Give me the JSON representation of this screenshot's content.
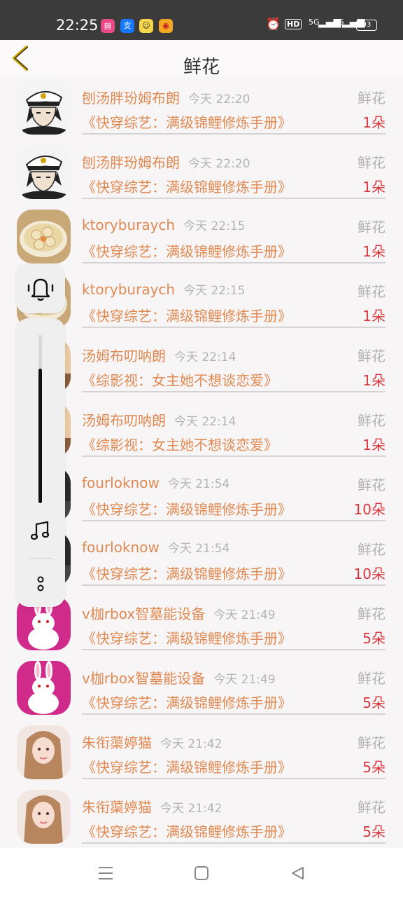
{
  "status_bar": {
    "time": "22:25",
    "hd_label": "HD",
    "signal_1": "5G",
    "signal_2": "4G",
    "battery": "93",
    "app_icons": [
      "pink-app-icon",
      "alipay-icon",
      "yellow-app-icon",
      "weibo-icon"
    ]
  },
  "header": {
    "title": "鲜花",
    "back_icon": "chevron-left-icon"
  },
  "rows": [
    {
      "name": "刨汤胖玢姆布朗",
      "time": "今天 22:20",
      "type": "鲜花",
      "book": "《快穿综艺：满级锦鲤修炼手册》",
      "count": "1朵",
      "avatar": "anime-captain"
    },
    {
      "name": "刨汤胖玢姆布朗",
      "time": "今天 22:20",
      "type": "鲜花",
      "book": "《快穿综艺：满级锦鲤修炼手册》",
      "count": "1朵",
      "avatar": "anime-captain"
    },
    {
      "name": "ktoryburaych",
      "time": "今天 22:15",
      "type": "鲜花",
      "book": "《快穿综艺：满级锦鲤修炼手册》",
      "count": "1朵",
      "avatar": "food-bowl"
    },
    {
      "name": "ktoryburaych",
      "time": "今天 22:15",
      "type": "鲜花",
      "book": "《快穿综艺：满级锦鲤修炼手册》",
      "count": "1朵",
      "avatar": "food-bowl"
    },
    {
      "name": "汤姆布叨呐朗",
      "time": "今天 22:14",
      "type": "鲜花",
      "book": "《综影视：女主她不想谈恋爱》",
      "count": "1朵",
      "avatar": "warm-photo"
    },
    {
      "name": "汤姆布叨呐朗",
      "time": "今天 22:14",
      "type": "鲜花",
      "book": "《综影视：女主她不想谈恋爱》",
      "count": "1朵",
      "avatar": "warm-photo"
    },
    {
      "name": "fourloknow",
      "time": "今天 21:54",
      "type": "鲜花",
      "book": "《快穿综艺：满级锦鲤修炼手册》",
      "count": "10朵",
      "avatar": "dark-photo"
    },
    {
      "name": "fourloknow",
      "time": "今天 21:54",
      "type": "鲜花",
      "book": "《快穿综艺：满级锦鲤修炼手册》",
      "count": "10朵",
      "avatar": "dark-photo"
    },
    {
      "name": "v枷rbox智墓能设备",
      "time": "今天 21:49",
      "type": "鲜花",
      "book": "《快穿综艺：满级锦鲤修炼手册》",
      "count": "5朵",
      "avatar": "white-rabbit"
    },
    {
      "name": "v枷rbox智墓能设备",
      "time": "今天 21:49",
      "type": "鲜花",
      "book": "《快穿综艺：满级锦鲤修炼手册》",
      "count": "5朵",
      "avatar": "white-rabbit"
    },
    {
      "name": "朱衔蕖婷猫",
      "time": "今天 21:42",
      "type": "鲜花",
      "book": "《快穿综艺：满级锦鲤修炼手册》",
      "count": "5朵",
      "avatar": "girl-portrait"
    },
    {
      "name": "朱衔蕖婷猫",
      "time": "今天 21:42",
      "type": "鲜花",
      "book": "《快穿综艺：满级锦鲤修炼手册》",
      "count": "5朵",
      "avatar": "girl-portrait"
    }
  ],
  "floating_panel": {
    "icons": [
      "bell-icon",
      "music-note-icon",
      "more-dots-icon"
    ],
    "volume_level": 0.8
  },
  "nav_bar": {
    "icons": [
      "menu-icon",
      "home-square-icon",
      "back-triangle-icon"
    ]
  },
  "colors": {
    "accent_text": "#e08a53",
    "count_red": "#d8363c",
    "muted": "#b3b3b3"
  }
}
